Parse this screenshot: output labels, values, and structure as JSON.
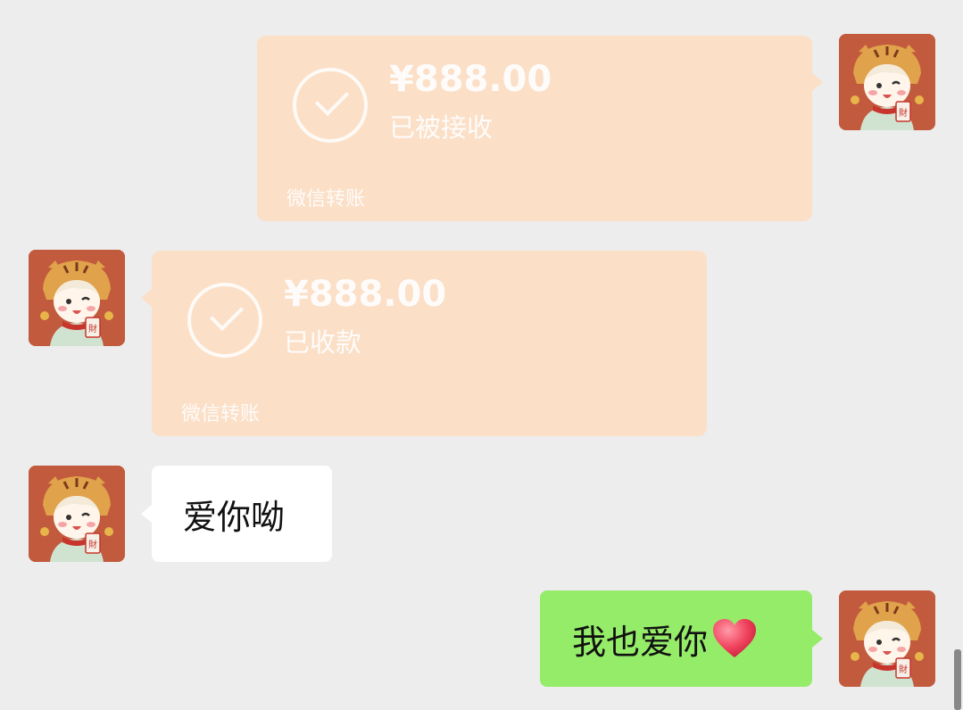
{
  "messages": [
    {
      "side": "right",
      "type": "transfer",
      "amount": "¥888.00",
      "status": "已被接收",
      "footer": "微信转账"
    },
    {
      "side": "left",
      "type": "transfer",
      "amount": "¥888.00",
      "status": "已收款",
      "footer": "微信转账"
    },
    {
      "side": "left",
      "type": "text",
      "text": "爱你呦"
    },
    {
      "side": "right",
      "type": "text",
      "text": "我也爱你"
    }
  ],
  "colors": {
    "background": "#ededed",
    "transfer_card": "#fbdfc7",
    "self_bubble": "#95ec69",
    "other_bubble": "#ffffff",
    "avatar_bg": "#c25a3d"
  },
  "icons": {
    "check": "check-circle-icon",
    "heart": "red-heart-emoji"
  }
}
